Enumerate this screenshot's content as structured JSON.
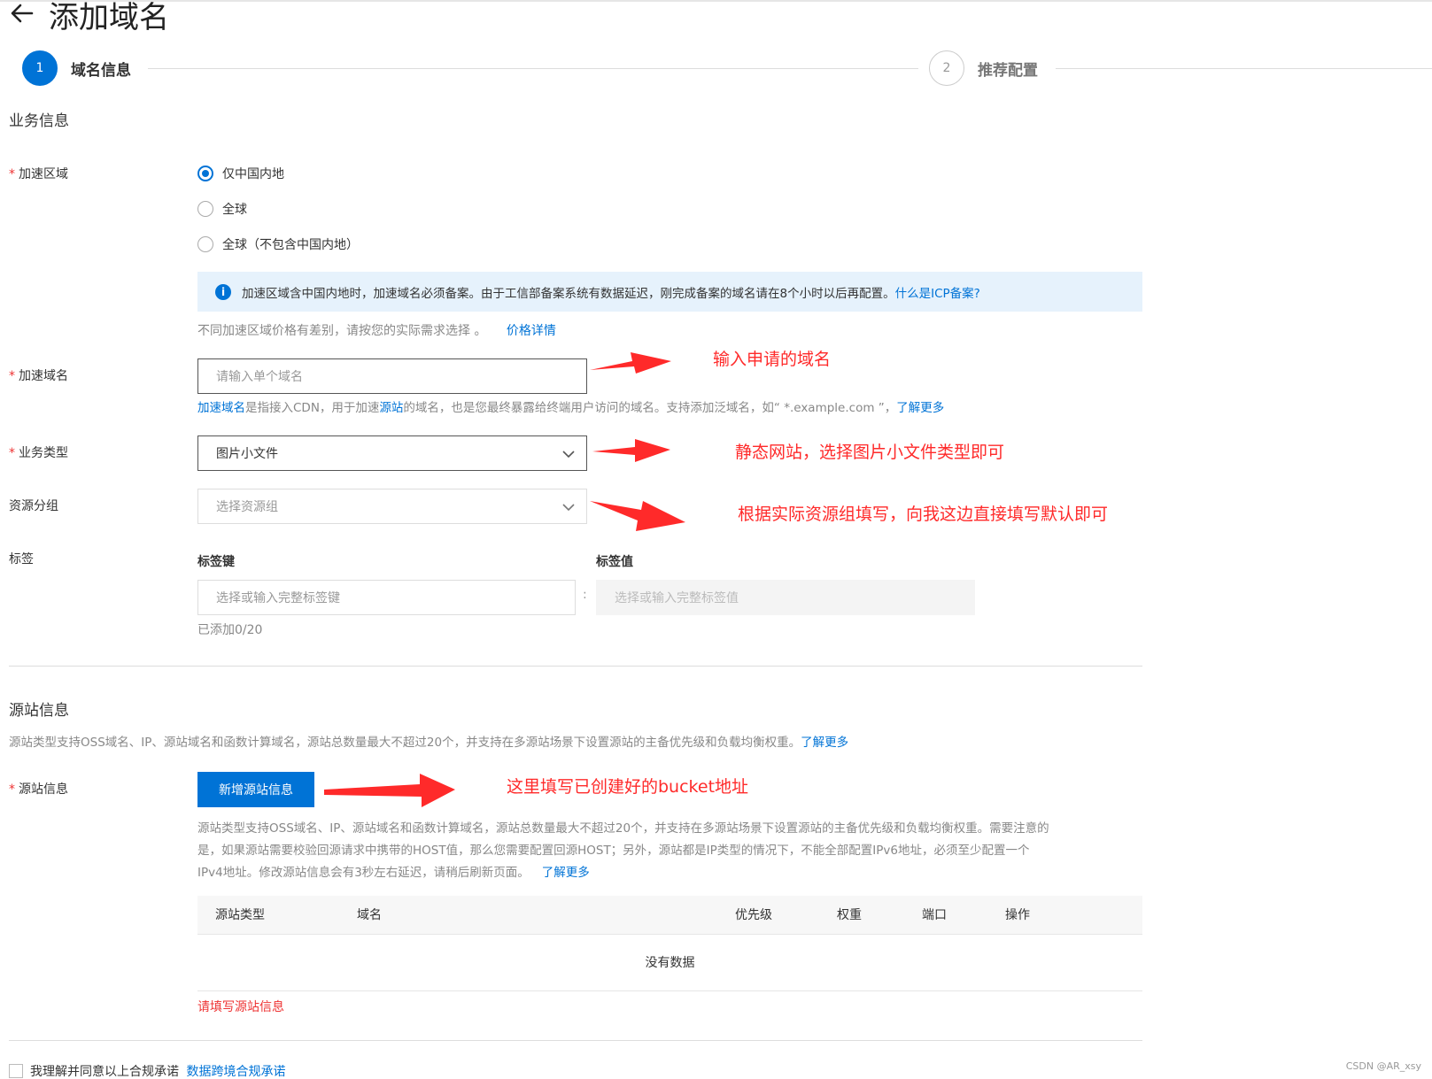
{
  "header": {
    "back_icon": "arrow-left-icon",
    "title": "添加域名"
  },
  "steps": [
    {
      "number": "1",
      "label": "域名信息",
      "active": true
    },
    {
      "number": "2",
      "label": "推荐配置",
      "active": false
    }
  ],
  "business": {
    "section_title": "业务信息",
    "region": {
      "required": "*",
      "label": "加速区域",
      "options": [
        "仅中国内地",
        "全球",
        "全球（不包含中国内地）"
      ],
      "selected": "仅中国内地",
      "notice_icon": "info-icon",
      "notice_text": "加速区域含中国内地时，加速域名必须备案。由于工信部备案系统有数据延迟，刚完成备案的域名请在8个小时以后再配置。",
      "notice_link": "什么是ICP备案?",
      "price_hint": "不同加速区域价格有差别，请按您的实际需求选择 。",
      "price_link": "价格详情"
    },
    "domain": {
      "required": "*",
      "label": "加速域名",
      "placeholder": "请输入单个域名",
      "help_link1": "加速域名",
      "help_text1": "是指接入CDN，用于加速",
      "help_link2": "源站",
      "help_text2": "的域名，也是您最终暴露给终端用户访问的域名。支持添加泛域名，如“ *.example.com ”，",
      "help_link3": "了解更多"
    },
    "type": {
      "required": "*",
      "label": "业务类型",
      "value": "图片小文件"
    },
    "resource_group": {
      "label": "资源分组",
      "placeholder": "选择资源组"
    },
    "tags": {
      "label": "标签",
      "key_label": "标签键",
      "value_label": "标签值",
      "key_placeholder": "选择或输入完整标签键",
      "value_placeholder": "选择或输入完整标签值",
      "separator": ":",
      "count": "已添加0/20"
    }
  },
  "origin": {
    "section_title": "源站信息",
    "desc": "源站类型支持OSS域名、IP、源站域名和函数计算域名，源站总数量最大不超过20个，并支持在多源站场景下设置源站的主备优先级和负载均衡权重。",
    "desc_link": "了解更多",
    "field": {
      "required": "*",
      "label": "源站信息",
      "add_button": "新增源站信息",
      "help_line1": "源站类型支持OSS域名、IP、源站域名和函数计算域名，源站总数量最大不超过20个，并支持在多源站场景下设置源站的主备优先级和负载均衡权重。需要注意的",
      "help_line2": "是，如果源站需要校验回源请求中携带的HOST值，那么您需要配置回源HOST；另外，源站都是IP类型的情况下，不能全部配置IPv6地址，必须至少配置一个",
      "help_line3": "IPv4地址。修改源站信息会有3秒左右延迟，请稍后刷新页面。",
      "help_link": "了解更多"
    },
    "table": {
      "columns": [
        "源站类型",
        "域名",
        "优先级",
        "权重",
        "端口",
        "操作"
      ],
      "empty_text": "没有数据"
    },
    "error": "请填写源站信息"
  },
  "agreement": {
    "text": "我理解并同意以上合规承诺",
    "link": "数据跨境合规承诺"
  },
  "annotations": [
    "输入申请的域名",
    "静态网站，选择图片小文件类型即可",
    "根据实际资源组填写，向我这边直接填写默认即可",
    "这里填写已创建好的bucket地址"
  ],
  "watermark": "CSDN @AR_xsy",
  "colors": {
    "primary": "#0073d6",
    "notice_bg": "#e6f2fc",
    "annotation": "#ff2a2a",
    "error": "#e33333"
  }
}
